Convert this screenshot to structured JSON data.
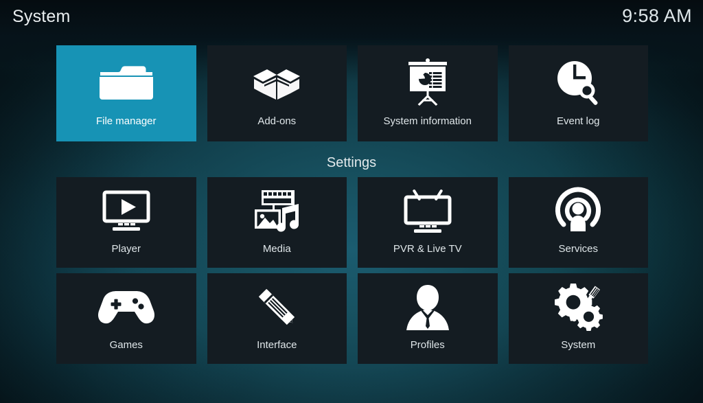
{
  "header": {
    "title": "System",
    "clock": "9:58 AM"
  },
  "colors": {
    "highlight": "#1793b5",
    "tile": "#141c22",
    "text": "#dfe6e9",
    "background_center": "#1b5c70",
    "background_edge": "#061318"
  },
  "sections": {
    "top": {
      "tiles": [
        {
          "label": "File manager",
          "icon": "folder-icon",
          "selected": true
        },
        {
          "label": "Add-ons",
          "icon": "open-box-icon",
          "selected": false
        },
        {
          "label": "System information",
          "icon": "presentation-icon",
          "selected": false
        },
        {
          "label": "Event log",
          "icon": "clock-search-icon",
          "selected": false
        }
      ]
    },
    "settings": {
      "heading": "Settings",
      "rows": [
        {
          "tiles": [
            {
              "label": "Player",
              "icon": "monitor-play-icon",
              "selected": false
            },
            {
              "label": "Media",
              "icon": "media-stack-icon",
              "selected": false
            },
            {
              "label": "PVR & Live TV",
              "icon": "tv-antenna-icon",
              "selected": false
            },
            {
              "label": "Services",
              "icon": "broadcast-icon",
              "selected": false
            }
          ]
        },
        {
          "tiles": [
            {
              "label": "Games",
              "icon": "gamepad-icon",
              "selected": false
            },
            {
              "label": "Interface",
              "icon": "pencil-ruler-icon",
              "selected": false
            },
            {
              "label": "Profiles",
              "icon": "person-icon",
              "selected": false
            },
            {
              "label": "System",
              "icon": "gears-tool-icon",
              "selected": false
            }
          ]
        }
      ]
    }
  }
}
